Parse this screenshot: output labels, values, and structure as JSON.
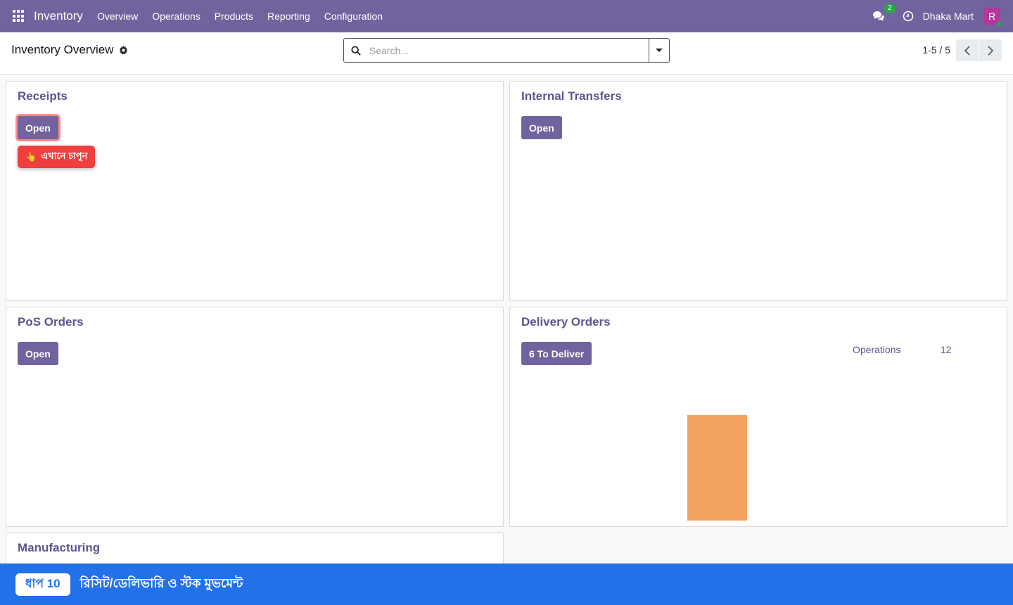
{
  "navbar": {
    "brand": "Inventory",
    "menu": [
      "Overview",
      "Operations",
      "Products",
      "Reporting",
      "Configuration"
    ],
    "chat_count": "2",
    "company": "Dhaka Mart",
    "avatar_letter": "R"
  },
  "control_panel": {
    "title": "Inventory Overview",
    "search_placeholder": "Search...",
    "pager": "1-5 / 5"
  },
  "cards": {
    "receipts": {
      "title": "Receipts",
      "button": "Open",
      "tooltip": "এখানে চাপুন",
      "tooltip_icon": "👆"
    },
    "internal": {
      "title": "Internal Transfers",
      "button": "Open"
    },
    "pos": {
      "title": "PoS Orders",
      "button": "Open"
    },
    "delivery": {
      "title": "Delivery Orders",
      "button": "6 To Deliver",
      "stat_label": "Operations",
      "stat_value": "12",
      "bar_color": "#f4a460"
    },
    "manufacturing": {
      "title": "Manufacturing"
    }
  },
  "banner": {
    "step": "ধাপ 10",
    "text": "রিসিট/ডেলিভারি ও স্টক মুভমেন্ট"
  },
  "colors": {
    "brand": "#71639e",
    "banner": "#2271e8",
    "tooltip": "#f03e3e"
  }
}
